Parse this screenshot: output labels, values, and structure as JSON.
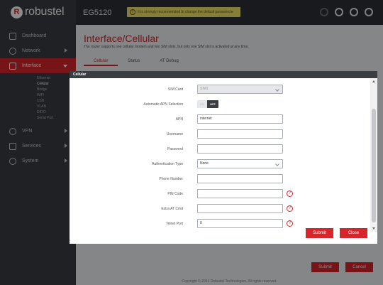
{
  "brand": {
    "logo_mark": "R",
    "name": "robustel"
  },
  "topbar": {
    "device": "EG5120",
    "warning_icon": "!",
    "warning": "It is strongly recommended to change the default password ▸",
    "icons": [
      "status-icon",
      "refresh-icon",
      "settings-icon",
      "logout-icon"
    ]
  },
  "sidebar": {
    "items": [
      {
        "label": "Dashboard",
        "icon": "dashboard-icon"
      },
      {
        "label": "Network",
        "icon": "network-icon"
      },
      {
        "label": "Interface",
        "icon": "interface-icon"
      },
      {
        "label": "VPN",
        "icon": "vpn-icon"
      },
      {
        "label": "Services",
        "icon": "services-icon"
      },
      {
        "label": "System",
        "icon": "system-icon"
      }
    ],
    "sub_items": [
      "Ethernet",
      "Cellular",
      "Bridge",
      "WiFi",
      "USB",
      "VLAN",
      "DIDO",
      "Serial Port"
    ]
  },
  "main": {
    "title": "Interface/Cellular",
    "description": "The router supports one cellular modem and two SIM slots, but only one SIM slot is activated at any time.",
    "tabs": [
      "Cellular",
      "Status",
      "AT Debug"
    ],
    "submit_label": "Submit",
    "cancel_label": "Cancel",
    "footer": "Copyright © 2021 Robustel Technologies. All rights reserved."
  },
  "modal": {
    "title": "Cellular",
    "fields": {
      "sim_card": {
        "label": "SIM Card",
        "value": "SIM1"
      },
      "auto_apn": {
        "label": "Automatic APN Selection",
        "on": "ON",
        "off": "OFF"
      },
      "apn": {
        "label": "APN",
        "value": "internet"
      },
      "username": {
        "label": "Username",
        "value": ""
      },
      "password": {
        "label": "Password",
        "value": ""
      },
      "auth_type": {
        "label": "Authentication Type",
        "value": "None"
      },
      "phone": {
        "label": "Phone Number",
        "value": ""
      },
      "pin": {
        "label": "PIN Code",
        "value": ""
      },
      "extra_at": {
        "label": "Extra AT Cmd",
        "value": ""
      },
      "telnet": {
        "label": "Telnet Port",
        "value": "0"
      }
    },
    "help_glyph": "?",
    "submit_label": "Submit",
    "close_label": "Close"
  },
  "colors": {
    "accent": "#d7262b",
    "sidebar": "#3a3d42",
    "topbar": "#2e3136",
    "warning": "#f2e36a"
  }
}
